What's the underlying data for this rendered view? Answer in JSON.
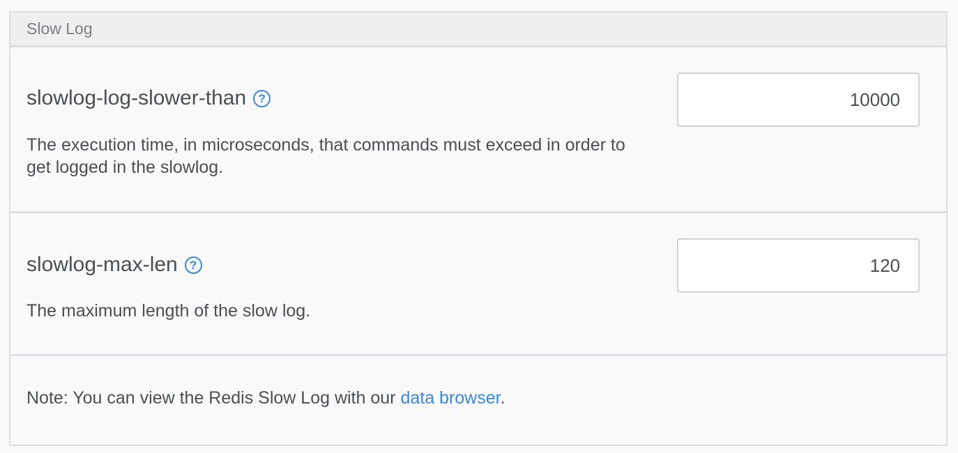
{
  "panel": {
    "title": "Slow Log"
  },
  "settings": [
    {
      "name": "slowlog-log-slower-than",
      "help_icon": "question-circle-icon",
      "help_glyph": "?",
      "description": "The execution time, in microseconds, that commands must exceed in order to get logged in the slowlog.",
      "value": "10000"
    },
    {
      "name": "slowlog-max-len",
      "help_icon": "question-circle-icon",
      "help_glyph": "?",
      "description": "The maximum length of the slow log.",
      "value": "120"
    }
  ],
  "note": {
    "prefix": "Note: You can view the Redis Slow Log with our ",
    "link_text": "data browser",
    "suffix": "."
  },
  "colors": {
    "accent": "#3a86d8",
    "text": "#4a4f55",
    "header_bg": "#eeefef",
    "border": "#dcdfe1"
  }
}
